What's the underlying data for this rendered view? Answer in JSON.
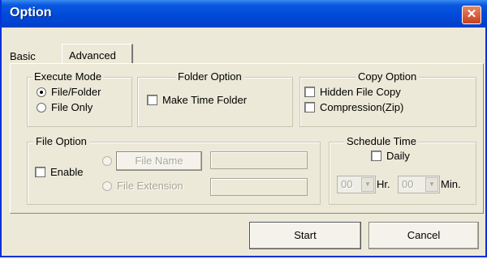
{
  "window": {
    "title": "Option",
    "close_glyph": "✕"
  },
  "tabs": [
    {
      "label": "Basic",
      "active": false
    },
    {
      "label": "Advanced",
      "active": true
    }
  ],
  "execute_mode": {
    "legend": "Execute Mode",
    "options": [
      {
        "label": "File/Folder",
        "selected": true
      },
      {
        "label": "File Only",
        "selected": false
      }
    ]
  },
  "folder_option": {
    "legend": "Folder Option",
    "make_time_folder": {
      "label": "Make Time Folder",
      "checked": false
    }
  },
  "copy_option": {
    "legend": "Copy Option",
    "hidden_file_copy": {
      "label": "Hidden File Copy",
      "checked": false
    },
    "compression": {
      "label": "Compression(Zip)",
      "checked": false
    }
  },
  "file_option": {
    "legend": "File Option",
    "enable": {
      "label": "Enable",
      "checked": false
    },
    "file_name_button": "File Name",
    "file_name_value": "",
    "file_extension_label": "File Extension",
    "file_extension_value": ""
  },
  "schedule_time": {
    "legend": "Schedule Time",
    "daily": {
      "label": "Daily",
      "checked": false
    },
    "hour_value": "00",
    "hour_unit": "Hr.",
    "minute_value": "00",
    "minute_unit": "Min."
  },
  "buttons": {
    "start": "Start",
    "cancel": "Cancel"
  },
  "icons": {
    "dropdown": "▼"
  }
}
